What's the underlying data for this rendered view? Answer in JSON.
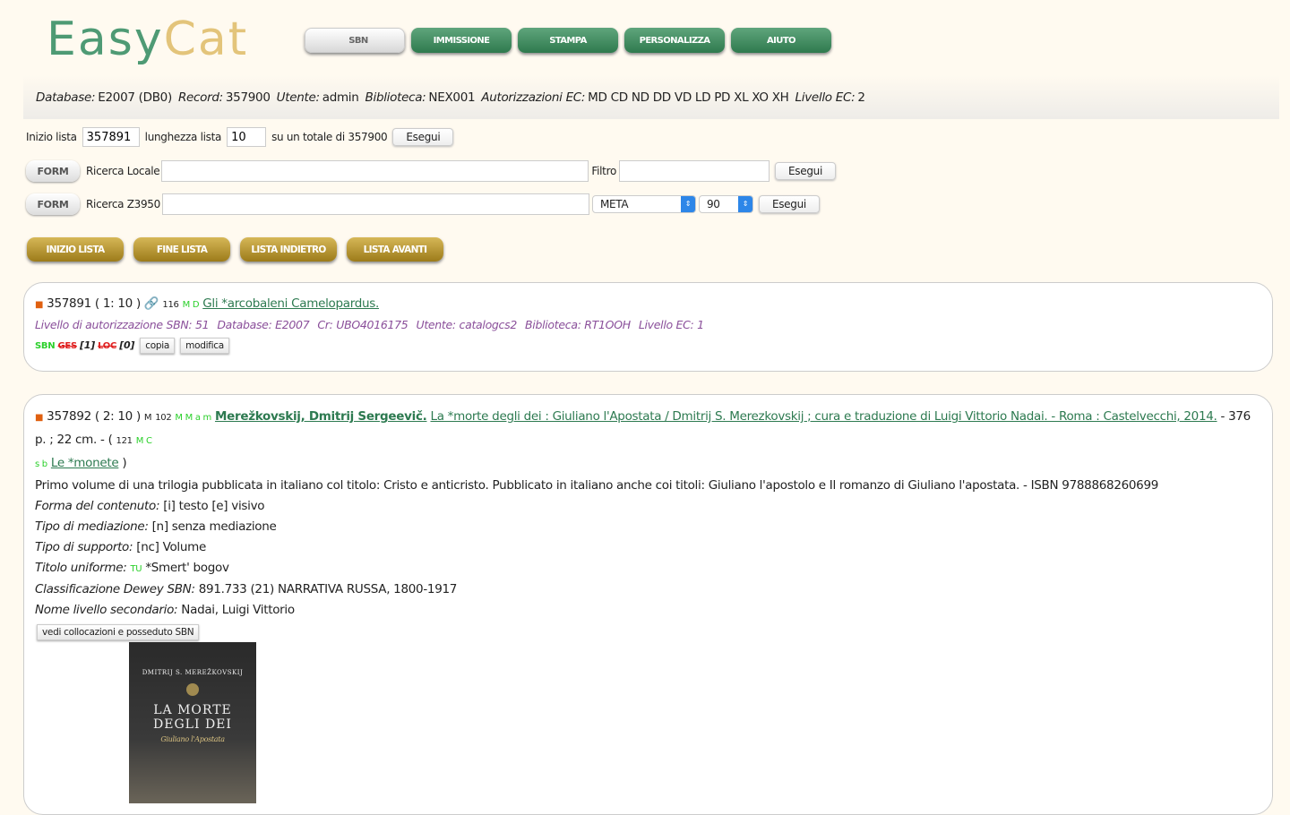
{
  "logo": {
    "part1": "Easy",
    "part2": "Cat"
  },
  "nav": [
    "SBN",
    "IMMISSIONE",
    "STAMPA",
    "PERSONALIZZA",
    "AIUTO"
  ],
  "info": [
    {
      "k": "Database:",
      "v": "E2007 (DB0)"
    },
    {
      "k": "Record:",
      "v": "357900"
    },
    {
      "k": "Utente:",
      "v": "admin"
    },
    {
      "k": "Biblioteca:",
      "v": "NEX001"
    },
    {
      "k": "Autorizzazioni EC:",
      "v": "MD CD ND DD VD LD PD XL XO XH"
    },
    {
      "k": "Livello EC:",
      "v": "2"
    }
  ],
  "list": {
    "start_label": "Inizio lista",
    "start": "357891",
    "len_label": "lunghezza lista",
    "len": "10",
    "total": "su un totale di 357900",
    "run": "Esegui"
  },
  "local": {
    "form": "FORM",
    "label": "Ricerca Locale",
    "filter": "Filtro",
    "run": "Esegui"
  },
  "z3950": {
    "form": "FORM",
    "label": "Ricerca Z3950",
    "target": "META",
    "count": "90",
    "run": "Esegui"
  },
  "paging": [
    "INIZIO LISTA",
    "FINE LISTA",
    "LISTA INDIETRO",
    "LISTA AVANTI"
  ],
  "rec1": {
    "id": "357891 ( 1: 10 )",
    "code": "116",
    "md": "M D",
    "title": "Gli *arcobaleni Camelopardus.",
    "meta": [
      "Livello di autorizzazione SBN: 51",
      "Database: E2007",
      "Cr: UBO4016175",
      "Utente: catalogcs2",
      "Biblioteca: RT1OOH",
      "Livello EC: 1"
    ],
    "sbn": "SBN",
    "ges": "GES",
    "ges_n": "[1]",
    "loc": "LOC",
    "loc_n": "[0]",
    "copy": "copia",
    "edit": "modifica"
  },
  "rec2": {
    "id": "357892 ( 2: 10 )",
    "m": "M",
    "code": "102",
    "mmam": "M M a m",
    "author": "Merežkovskij, Dmitrij Sergeevič.",
    "title": "La *morte degli dei : Giuliano l'Apostata / Dmitrij S. Merezkovskij ; cura e traduzione di Luigi Vittorio Nadai. - Roma : Castelvecchi, 2014.",
    "phys": "- 376 p. ; 22 cm. - (",
    "code2": "121",
    "mc": "M C",
    "sb": "s b",
    "series": "Le *monete",
    "close": ")",
    "note": "Primo volume di una trilogia pubblicata in italiano col titolo: Cristo e anticristo. Pubblicato in italiano anche coi titoli: Giuliano l'apostolo e Il romanzo di Giuliano l'apostata. - ISBN 9788868260699",
    "fields": [
      {
        "k": "Forma del contenuto:",
        "v": "[i] testo [e] visivo"
      },
      {
        "k": "Tipo di mediazione:",
        "v": "[n] senza mediazione"
      },
      {
        "k": "Tipo di supporto:",
        "v": "[nc] Volume"
      },
      {
        "k": "Titolo uniforme:",
        "tu": "TU",
        "v": "*Smert' bogov"
      },
      {
        "k": "Classificazione Dewey SBN:",
        "v": "891.733 (21) NARRATIVA RUSSA, 1800-1917"
      },
      {
        "k": "Nome livello secondario:",
        "v": "Nadai, Luigi Vittorio"
      }
    ],
    "holdings": "vedi collocazioni e posseduto SBN",
    "cover": {
      "author": "DMITRIJ S. MEREŽKOVSKIJ",
      "title1": "LA MORTE",
      "title2": "DEGLI DEI",
      "subtitle": "Giuliano l'Apostata"
    }
  }
}
